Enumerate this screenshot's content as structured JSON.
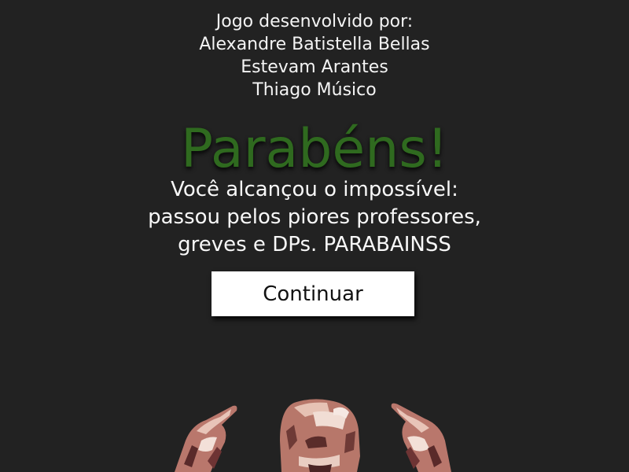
{
  "credits": {
    "heading": "Jogo desenvolvido por:",
    "authors": [
      "Alexandre Batistella Bellas",
      "Estevam Arantes",
      "Thiago Músico"
    ]
  },
  "title": "Parabéns!",
  "message": {
    "lines": [
      "Você alcançou o impossível:",
      "passou pelos piores professores,",
      "greves e DPs. PARABAINSS"
    ]
  },
  "continue_button": {
    "label": "Continuar"
  },
  "character": {
    "icon": "pointing-character-icon"
  },
  "colors": {
    "background": "#222222",
    "title": "#2f6a1f",
    "text": "#f4f4f4",
    "button": "#ffffff"
  }
}
